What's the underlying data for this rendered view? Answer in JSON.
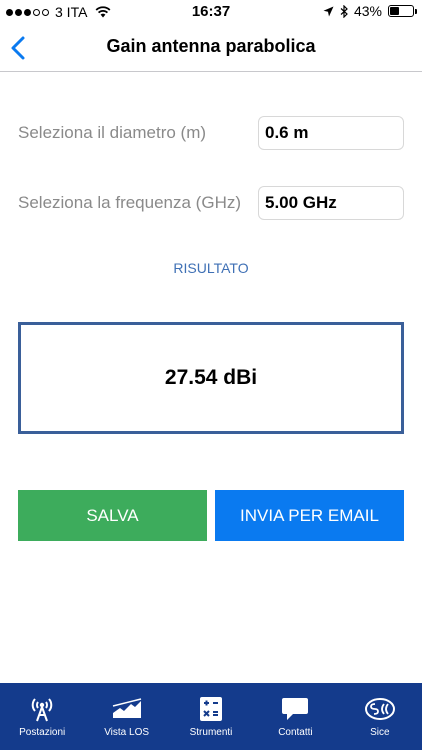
{
  "status_bar": {
    "carrier": "3 ITA",
    "time": "16:37",
    "battery": "43%",
    "battery_level": 0.43
  },
  "nav": {
    "title": "Gain antenna parabolica"
  },
  "form": {
    "diameter_label": "Seleziona il diametro (m)",
    "diameter_value": "0.6 m",
    "frequency_label": "Seleziona la frequenza (GHz)",
    "frequency_value": "5.00 GHz"
  },
  "result": {
    "label": "RISULTATO",
    "value": "27.54 dBi"
  },
  "buttons": {
    "save": "SALVA",
    "email": "INVIA PER EMAIL"
  },
  "tabs": [
    {
      "label": "Postazioni",
      "icon": "antenna-tower-icon"
    },
    {
      "label": "Vista LOS",
      "icon": "terrain-profile-icon"
    },
    {
      "label": "Strumenti",
      "icon": "calculator-icon"
    },
    {
      "label": "Contatti",
      "icon": "chat-bubble-icon"
    },
    {
      "label": "Sice",
      "icon": "sice-logo-icon"
    }
  ],
  "colors": {
    "accent_blue": "#0a7af0",
    "save_green": "#3dac5c",
    "tab_bar": "#143b8c",
    "result_border": "#3a5f99",
    "result_label": "#3f70b5"
  }
}
